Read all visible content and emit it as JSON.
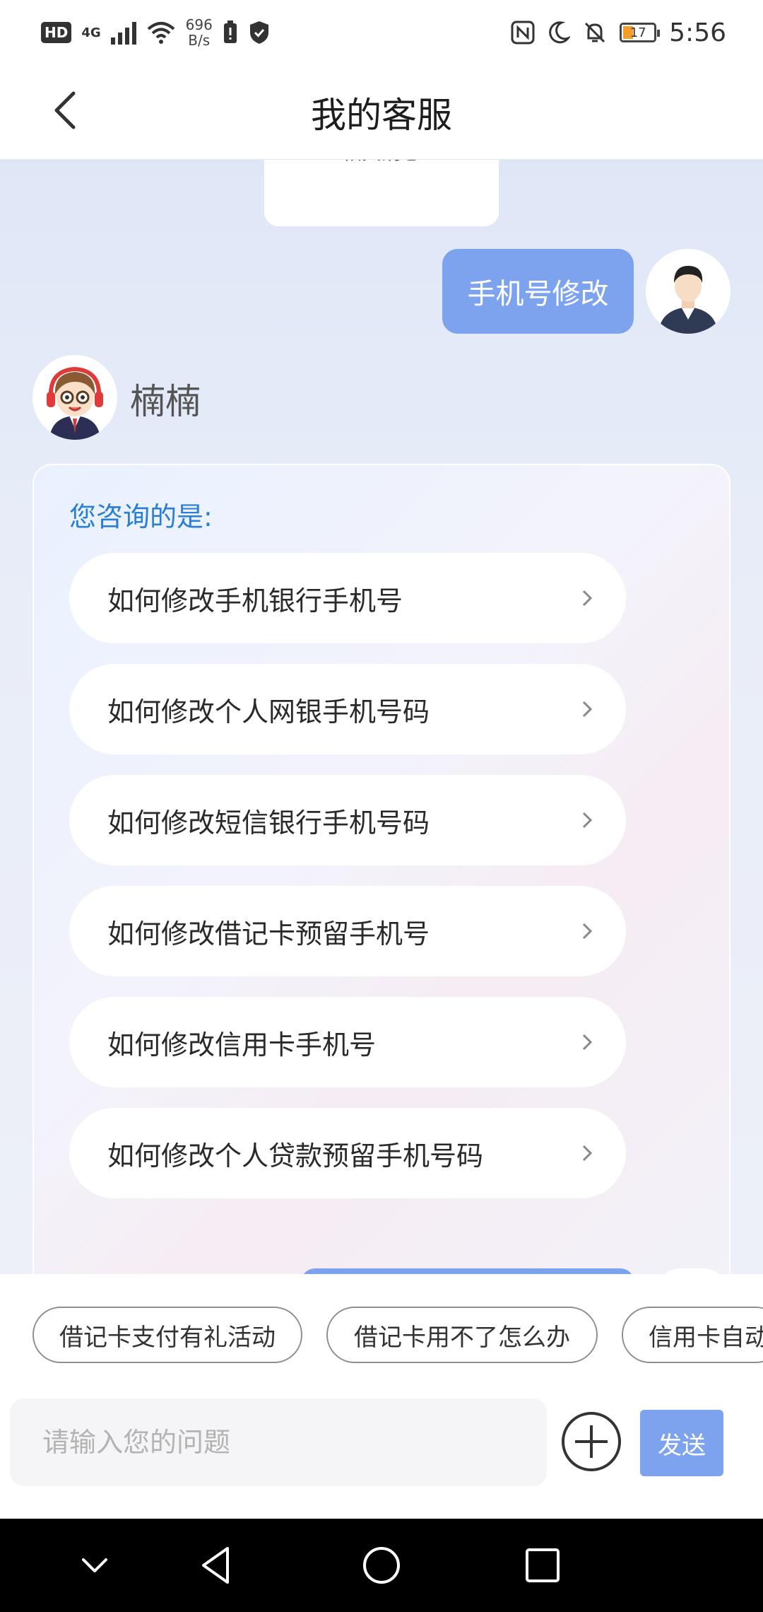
{
  "status_bar": {
    "hd": "HD",
    "network": "4G",
    "speed_value": "696",
    "speed_unit": "B/s",
    "battery_level": "17",
    "time": "5:56"
  },
  "header": {
    "title": "我的客服"
  },
  "chat": {
    "previous_card_text": "相关消息",
    "user_message": "手机号修改",
    "agent_name": "楠楠",
    "faq_heading": "您咨询的是:",
    "faq_items": [
      {
        "label": "如何修改手机银行手机号"
      },
      {
        "label": "如何修改个人网银手机号码"
      },
      {
        "label": "如何修改短信银行手机号码"
      },
      {
        "label": "如何修改借记卡预留手机号"
      },
      {
        "label": "如何修改信用卡手机号"
      },
      {
        "label": "如何修改个人贷款预留手机号码"
      }
    ]
  },
  "suggestions": [
    {
      "label": "借记卡支付有礼活动"
    },
    {
      "label": "借记卡用不了怎么办"
    },
    {
      "label": "信用卡自动"
    }
  ],
  "input": {
    "placeholder": "请输入您的问题",
    "send_label": "发送"
  },
  "colors": {
    "accent": "#7ea3ee",
    "heading_blue": "#2a7fd4"
  }
}
